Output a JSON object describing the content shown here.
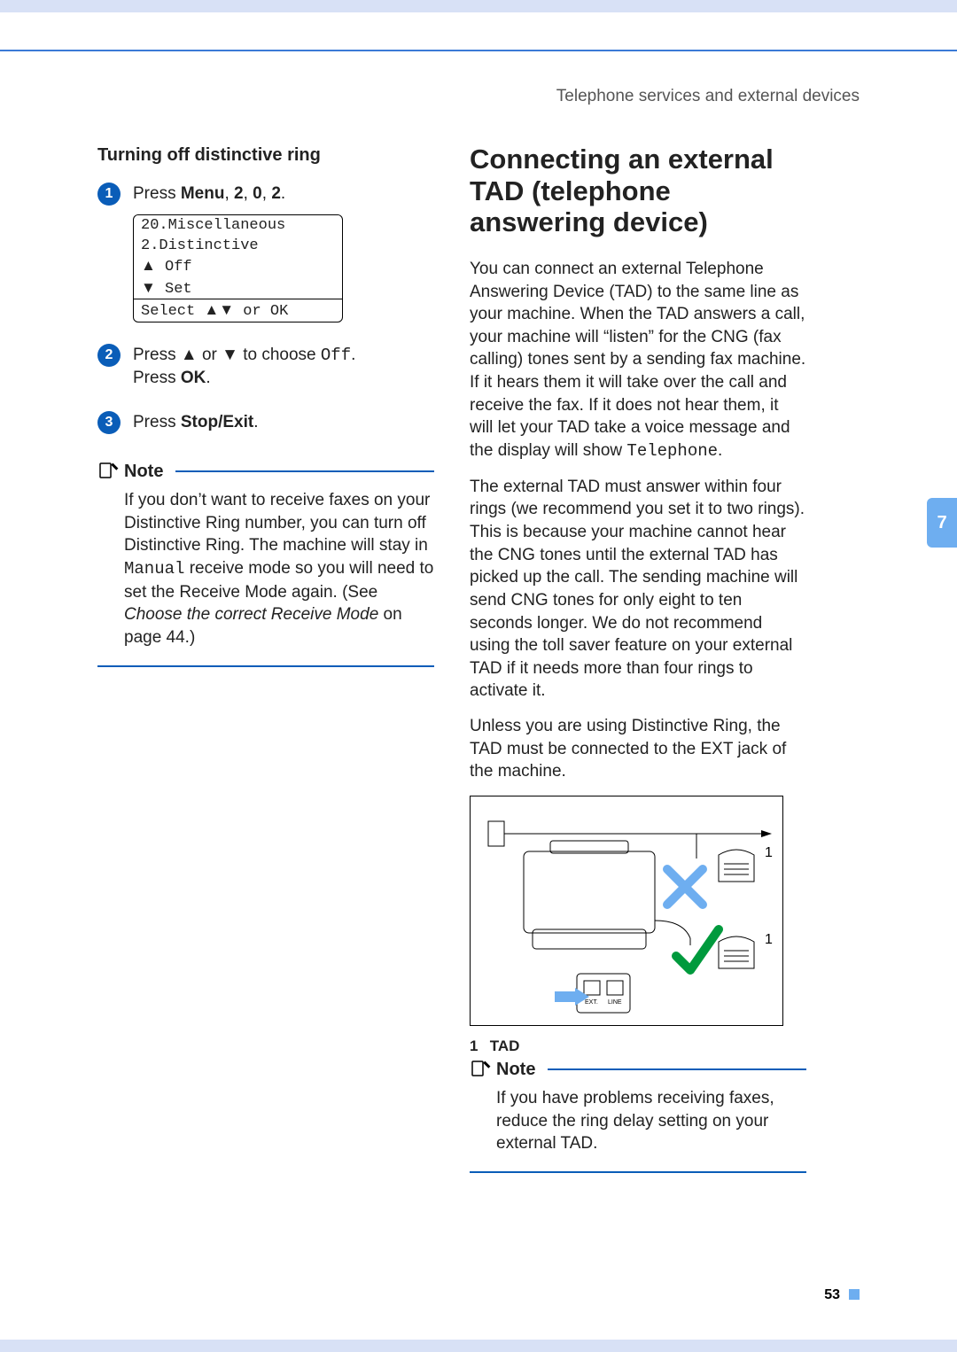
{
  "running_header": "Telephone services and external devices",
  "tab_number": "7",
  "page_number": "53",
  "left": {
    "section_title": "Turning off distinctive ring",
    "steps": [
      {
        "num": "1",
        "parts": [
          "Press ",
          {
            "b": "Menu"
          },
          ", ",
          {
            "b": "2"
          },
          ", ",
          {
            "b": "0"
          },
          ", ",
          {
            "b": "2"
          },
          "."
        ]
      },
      {
        "num": "2",
        "parts": [
          "Press ",
          {
            "sym": "a"
          },
          " or ",
          {
            "sym": "b"
          },
          " to choose ",
          {
            "mono": "Off"
          },
          ".\nPress ",
          {
            "b": "OK"
          },
          "."
        ]
      },
      {
        "num": "3",
        "parts": [
          "Press ",
          {
            "b": "Stop/Exit"
          },
          "."
        ]
      }
    ],
    "lcd": {
      "line1": "20.Miscellaneous",
      "line2": "  2.Distinctive",
      "line3_sym": "a",
      "line3_text": "    Off",
      "line4_sym": "b",
      "line4_text": "    Set",
      "footer": "Select ab or OK",
      "footer_prefix": "Select ",
      "footer_arrows": "ab",
      "footer_suffix": " or OK"
    },
    "note": {
      "label": "Note",
      "body_parts": [
        "If you don’t want to receive faxes on your Distinctive Ring number, you can turn off Distinctive Ring. The machine will stay in ",
        {
          "mono": "Manual"
        },
        " receive mode so you will need to set the Receive Mode again. (See ",
        {
          "i": "Choose the correct Receive Mode"
        },
        " on page 44.)"
      ]
    }
  },
  "right": {
    "heading": "Connecting an external TAD (telephone answering device)",
    "paras": [
      [
        "You can connect an external Telephone Answering Device (TAD) to the same line as your machine. When the TAD answers a call, your machine will “listen” for the CNG (fax calling) tones sent by a sending fax machine. If it hears them it will take over the call and receive the fax. If it does not hear them, it will let your TAD take a voice message and the display will show ",
        {
          "mono": "Telephone"
        },
        "."
      ],
      [
        "The external TAD must answer within four rings (we recommend you set it to two rings). This is because your machine cannot hear the CNG tones until the external TAD has picked up the call. The sending machine will send CNG tones for only eight to ten seconds longer. We do not recommend using the toll saver feature on your external TAD if it needs more than four rings to activate it."
      ],
      [
        "Unless you are using Distinctive Ring, the TAD must be connected to the EXT jack of the machine."
      ]
    ],
    "diagram": {
      "label_top": "1",
      "label_bottom": "1",
      "legend_num": "1",
      "legend_text": "TAD"
    },
    "note": {
      "label": "Note",
      "body": "If you have problems receiving faxes, reduce the ring delay setting on your external TAD."
    }
  }
}
